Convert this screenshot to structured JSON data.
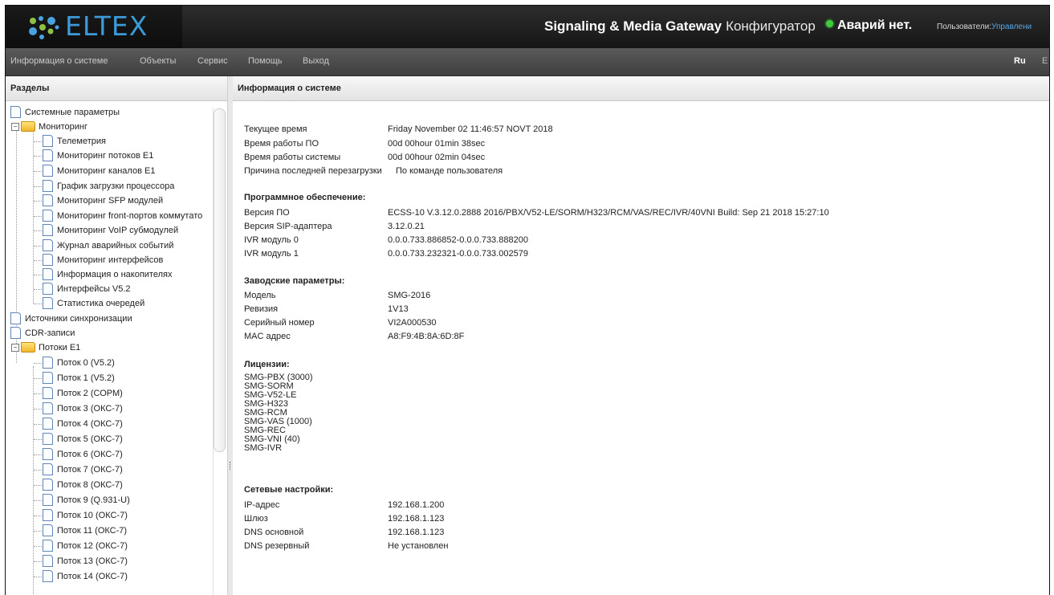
{
  "header": {
    "logo_text": "ELTEX",
    "title_bold": "Signaling & Media Gateway",
    "title_normal": "Конфигуратор",
    "alarm_text": "Аварий нет.",
    "users_label": "Пользователи:",
    "users_link": "Управлени"
  },
  "menu": {
    "items": [
      "Информация о системе",
      "Объекты",
      "Сервис",
      "Помощь",
      "Выход"
    ],
    "lang_active": "Ru",
    "lang_other": "E"
  },
  "sidebar": {
    "title": "Разделы",
    "items": [
      "Системные параметры",
      "Мониторинг",
      "Телеметрия",
      "Мониторинг потоков E1",
      "Мониторинг каналов E1",
      "График загрузки процессора",
      "Мониторинг SFP модулей",
      "Мониторинг front-портов коммутато",
      "Мониторинг VoIP субмодулей",
      "Журнал аварийных событий",
      "Мониторинг интерфейсов",
      "Информация о накопителях",
      "Интерфейсы V5.2",
      "Статистика очередей",
      "Источники синхронизации",
      "CDR-записи",
      "Потоки E1",
      "Поток 0 (V5.2)",
      "Поток 1 (V5.2)",
      "Поток 2 (СОРМ)",
      "Поток 3 (ОКС-7)",
      "Поток 4 (ОКС-7)",
      "Поток 5 (ОКС-7)",
      "Поток 6 (ОКС-7)",
      "Поток 7 (ОКС-7)",
      "Поток 8 (ОКС-7)",
      "Поток 9 (Q.931-U)",
      "Поток 10 (ОКС-7)",
      "Поток 11 (ОКС-7)",
      "Поток 12 (ОКС-7)",
      "Поток 13 (ОКС-7)",
      "Поток 14 (ОКС-7)"
    ]
  },
  "main": {
    "title": "Информация о системе",
    "general": [
      {
        "label": "Текущее время",
        "value": "Friday November 02 11:46:57 NOVT 2018"
      },
      {
        "label": "Время работы ПО",
        "value": "00d 00hour 01min 38sec"
      },
      {
        "label": "Время работы системы",
        "value": "00d 00hour 02min 04sec"
      },
      {
        "label": "Причина последней перезагрузки",
        "value": "По команде пользователя"
      }
    ],
    "software_title": "Программное обеспечение:",
    "software": [
      {
        "label": "Версия ПО",
        "value": "ECSS-10 V.3.12.0.2888 2016/PBX/V52-LE/SORM/H323/RCM/VAS/REC/IVR/40VNI Build: Sep 21 2018 15:27:10"
      },
      {
        "label": "Версия SIP-адаптера",
        "value": "3.12.0.21"
      },
      {
        "label": "IVR модуль 0",
        "value": "0.0.0.733.886852-0.0.0.733.888200"
      },
      {
        "label": "IVR модуль 1",
        "value": "0.0.0.733.232321-0.0.0.733.002579"
      }
    ],
    "factory_title": "Заводские параметры:",
    "factory": [
      {
        "label": "Модель",
        "value": "SMG-2016"
      },
      {
        "label": "Ревизия",
        "value": "1V13"
      },
      {
        "label": "Серийный номер",
        "value": "VI2A000530"
      },
      {
        "label": "MAC адрес",
        "value": "A8:F9:4B:8A:6D:8F"
      }
    ],
    "licenses_title": "Лицензии:",
    "licenses": [
      "SMG-PBX (3000)",
      "SMG-SORM",
      "SMG-V52-LE",
      "SMG-H323",
      "SMG-RCM",
      "SMG-VAS (1000)",
      "SMG-REC",
      "SMG-VNI (40)",
      "SMG-IVR"
    ],
    "network_title": "Сетевые настройки:",
    "network": [
      {
        "label": "IP-адрес",
        "value": "192.168.1.200"
      },
      {
        "label": "Шлюз",
        "value": "192.168.1.123"
      },
      {
        "label": "DNS основной",
        "value": "192.168.1.123"
      },
      {
        "label": "DNS резервный",
        "value": "Не установлен"
      }
    ]
  },
  "colors": {
    "logo_blue": "#3d9ad8",
    "alarm_ok": "#3dcc3d",
    "header_bg": "#1f1f1f",
    "menubar_bg": "#4a4a4a"
  }
}
